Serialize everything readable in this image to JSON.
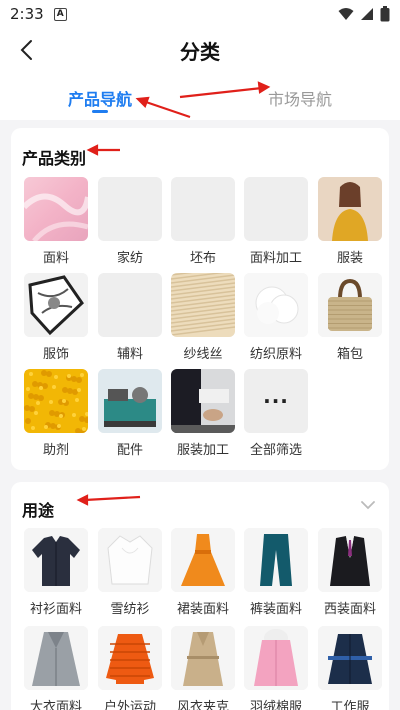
{
  "status_bar": {
    "time": "2:33",
    "badge": "A",
    "icons": [
      "wifi-icon",
      "signal-icon",
      "battery-icon"
    ]
  },
  "header": {
    "title": "分类",
    "back_icon": "back-chevron-icon"
  },
  "tabs": [
    {
      "label": "产品导航",
      "active": true
    },
    {
      "label": "市场导航",
      "active": false
    }
  ],
  "colors": {
    "accent": "#1f7df0",
    "annotation_arrow": "#e0201a",
    "inactive_tab": "#999999"
  },
  "product_categories": {
    "title": "产品类别",
    "items": [
      {
        "label": "面料",
        "image": "pink-fabric-photo"
      },
      {
        "label": "家纺",
        "image": "placeholder"
      },
      {
        "label": "坯布",
        "image": "placeholder"
      },
      {
        "label": "面料加工",
        "image": "placeholder"
      },
      {
        "label": "服装",
        "image": "woman-yellow-sweater-photo"
      },
      {
        "label": "服饰",
        "image": "silk-scarf-photo"
      },
      {
        "label": "辅料",
        "image": "placeholder"
      },
      {
        "label": "纱线丝",
        "image": "yarn-photo"
      },
      {
        "label": "纺织原料",
        "image": "cotton-fiber-photo"
      },
      {
        "label": "箱包",
        "image": "straw-handbag-photo"
      },
      {
        "label": "助剂",
        "image": "yellow-powder-photo"
      },
      {
        "label": "配件",
        "image": "textile-machine-photo"
      },
      {
        "label": "服装加工",
        "image": "sewing-worker-photo"
      },
      {
        "label": "全部筛选",
        "image": "more-dots-icon",
        "dots": "···"
      }
    ]
  },
  "usage": {
    "title": "用途",
    "collapse_icon": "chevron-down-icon",
    "items": [
      {
        "label": "衬衫面料",
        "image": "dark-shirt-photo"
      },
      {
        "label": "雪纺衫",
        "image": "white-blouse-photo"
      },
      {
        "label": "裙装面料",
        "image": "orange-dress-photo"
      },
      {
        "label": "裤装面料",
        "image": "teal-pants-photo"
      },
      {
        "label": "西装面料",
        "image": "black-suit-photo"
      },
      {
        "label": "大衣面料",
        "image": "grey-coat-photo"
      },
      {
        "label": "户外运动",
        "image": "orange-down-jacket-photo"
      },
      {
        "label": "风衣夹克",
        "image": "beige-trench-photo"
      },
      {
        "label": "羽绒棉服",
        "image": "pink-parka-photo"
      },
      {
        "label": "工作服",
        "image": "navy-workwear-photo"
      }
    ]
  }
}
